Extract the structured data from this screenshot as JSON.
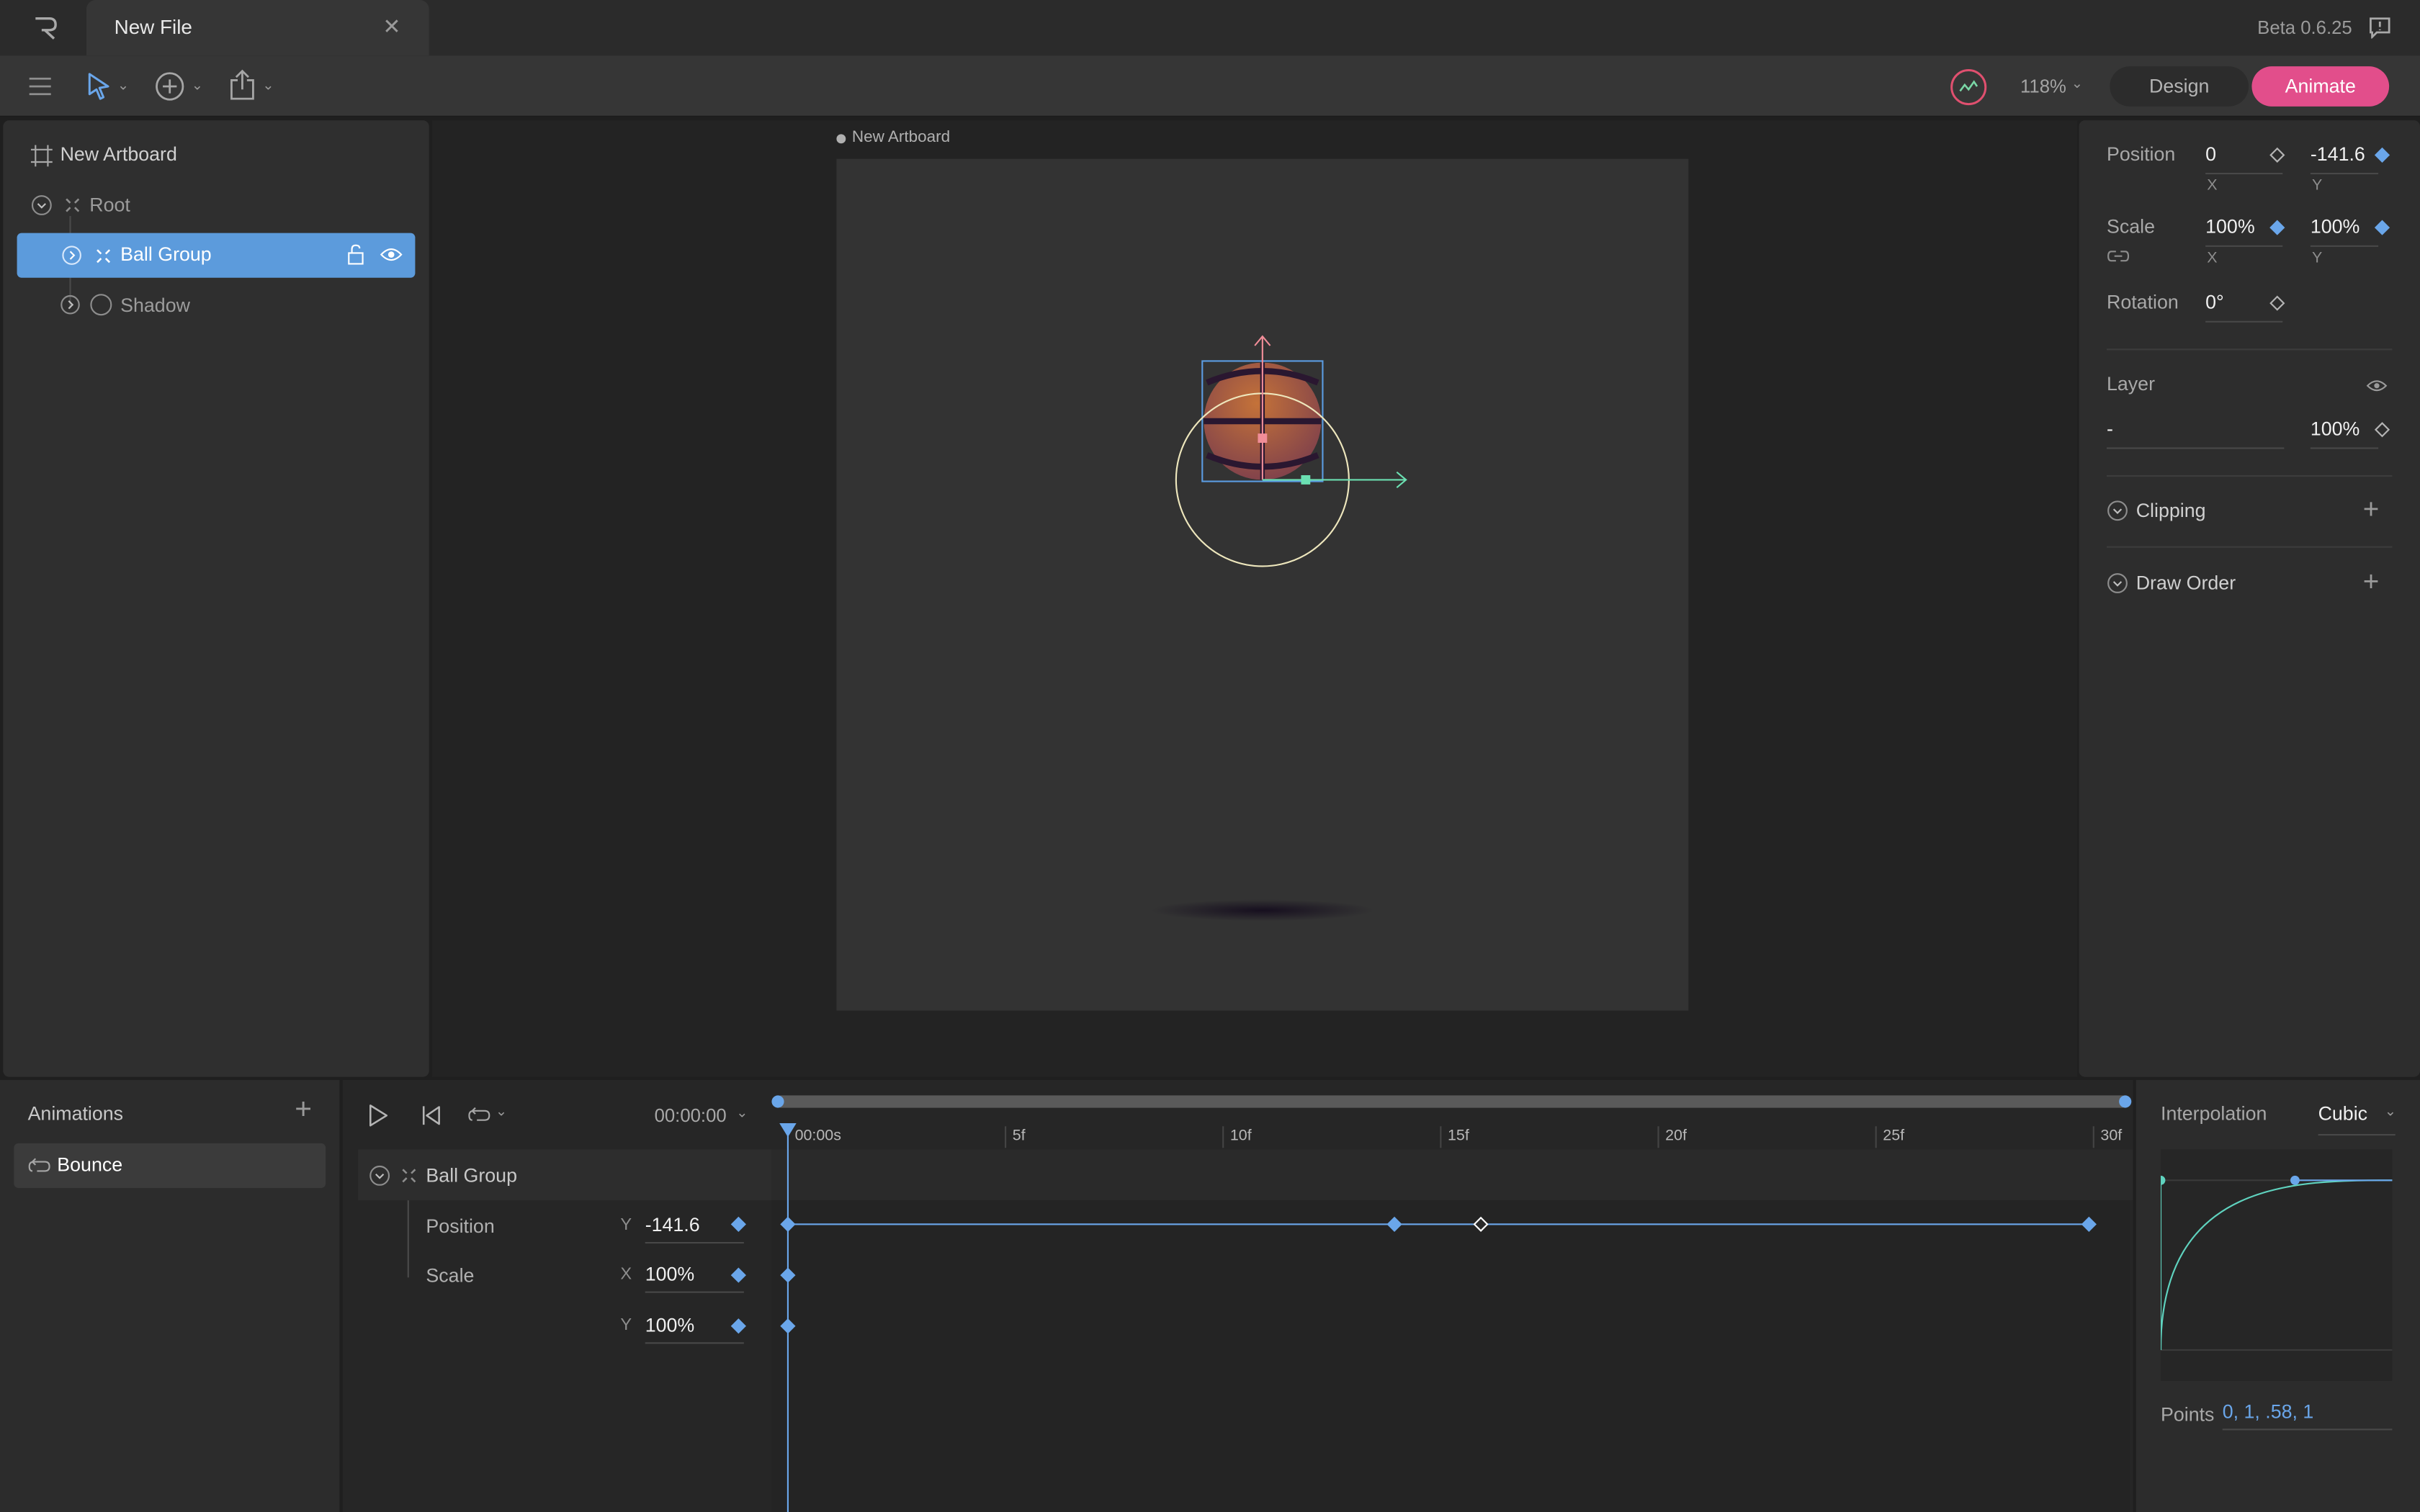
{
  "titlebar": {
    "tab_title": "New File",
    "version": "Beta 0.6.25"
  },
  "toolbar": {
    "zoom": "118%",
    "design_label": "Design",
    "animate_label": "Animate",
    "animate_color": "#e24e8b"
  },
  "hierarchy": {
    "artboard": "New Artboard",
    "items": [
      {
        "label": "Root"
      },
      {
        "label": "Ball Group",
        "selected": true
      },
      {
        "label": "Shadow"
      }
    ]
  },
  "stage": {
    "artboard_label": "New Artboard"
  },
  "inspector": {
    "position_label": "Position",
    "position_x": "0",
    "position_y": "-141.6",
    "axis_x": "X",
    "axis_y": "Y",
    "scale_label": "Scale",
    "scale_x": "100%",
    "scale_y": "100%",
    "rotation_label": "Rotation",
    "rotation": "0°",
    "layer_label": "Layer",
    "layer_blend": "-",
    "layer_opacity": "100%",
    "clipping_label": "Clipping",
    "draw_order_label": "Draw Order"
  },
  "animations": {
    "title": "Animations",
    "items": [
      {
        "label": "Bounce"
      }
    ]
  },
  "timeline": {
    "time": "00:00:00",
    "ticks": [
      "00:00s",
      "5f",
      "10f",
      "15f",
      "20f",
      "25f",
      "30f"
    ],
    "group": "Ball Group",
    "tracks": [
      {
        "property": "Position",
        "axis": "Y",
        "value": "-141.6",
        "keyframes": [
          0,
          14,
          16,
          30
        ]
      },
      {
        "property": "Scale",
        "axis": "X",
        "value": "100%",
        "keyframes": [
          0
        ]
      },
      {
        "property": "",
        "axis": "Y",
        "value": "100%",
        "keyframes": [
          0
        ]
      }
    ]
  },
  "interpolation": {
    "label": "Interpolation",
    "type": "Cubic",
    "points_label": "Points",
    "points": "0, 1, .58, 1"
  }
}
